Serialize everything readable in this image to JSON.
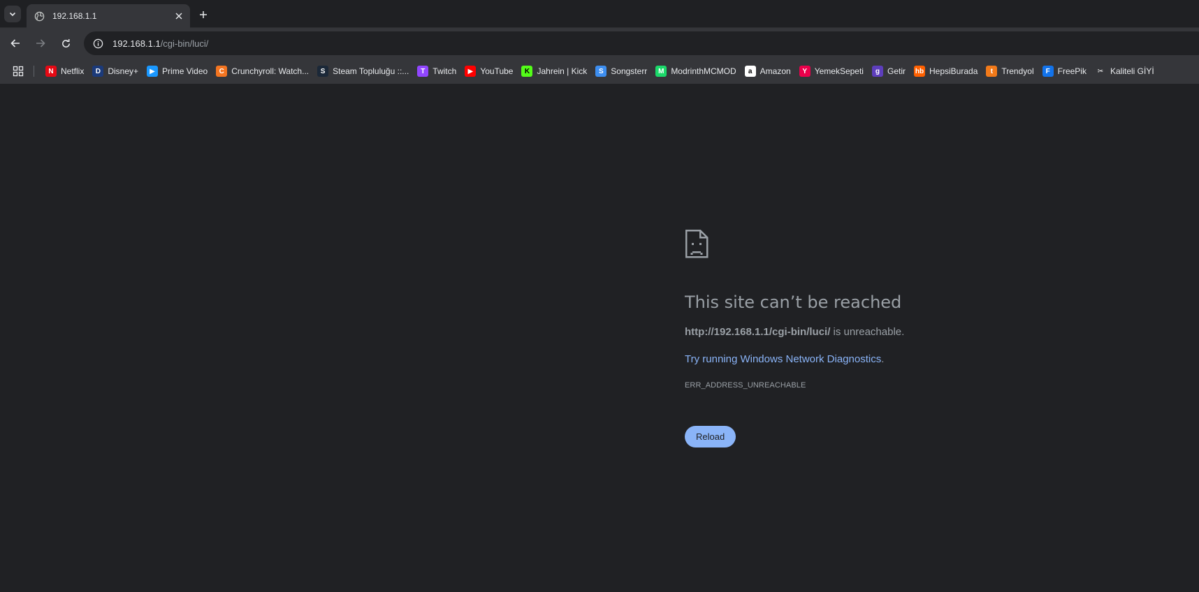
{
  "browser": {
    "tab": {
      "title": "192.168.1.1"
    },
    "omnibox": {
      "host": "192.168.1.1",
      "path": "/cgi-bin/luci/"
    },
    "bookmarks": [
      {
        "label": "Netflix",
        "icon": "netflix-icon",
        "color": "#e50914",
        "glyph": "N"
      },
      {
        "label": "Disney+",
        "icon": "disney-icon",
        "color": "#1b3a7a",
        "glyph": "D"
      },
      {
        "label": "Prime Video",
        "icon": "prime-video-icon",
        "color": "#1a98ff",
        "glyph": "▶"
      },
      {
        "label": "Crunchyroll: Watch...",
        "icon": "crunchyroll-icon",
        "color": "#f47521",
        "glyph": "C"
      },
      {
        "label": "Steam Topluluğu ::...",
        "icon": "steam-icon",
        "color": "#1b2838",
        "glyph": "S"
      },
      {
        "label": "Twitch",
        "icon": "twitch-icon",
        "color": "#9146ff",
        "glyph": "T"
      },
      {
        "label": "YouTube",
        "icon": "youtube-icon",
        "color": "#ff0000",
        "glyph": "▶"
      },
      {
        "label": "Jahrein | Kick",
        "icon": "kick-icon",
        "color": "#53fc18",
        "glyph": "K"
      },
      {
        "label": "Songsterr",
        "icon": "songsterr-icon",
        "color": "#3d8ef0",
        "glyph": "S"
      },
      {
        "label": "ModrinthMCMOD",
        "icon": "modrinth-icon",
        "color": "#1bd96a",
        "glyph": "M"
      },
      {
        "label": "Amazon",
        "icon": "amazon-icon",
        "color": "#ffffff",
        "glyph": "a"
      },
      {
        "label": "YemekSepeti",
        "icon": "yemeksepeti-icon",
        "color": "#ea004b",
        "glyph": "Y"
      },
      {
        "label": "Getir",
        "icon": "getir-icon",
        "color": "#5d3ebc",
        "glyph": "g"
      },
      {
        "label": "HepsiBurada",
        "icon": "hepsiburada-icon",
        "color": "#ff6000",
        "glyph": "hb"
      },
      {
        "label": "Trendyol",
        "icon": "trendyol-icon",
        "color": "#f27a1a",
        "glyph": "t"
      },
      {
        "label": "FreePik",
        "icon": "freepik-icon",
        "color": "#1273eb",
        "glyph": "F"
      },
      {
        "label": "Kaliteli GİYİ",
        "icon": "scissors-icon",
        "color": "#35363a",
        "glyph": "✂"
      }
    ]
  },
  "error": {
    "title": "This site can’t be reached",
    "url_bold": "http://192.168.1.1/cgi-bin/luci/",
    "url_suffix": " is unreachable.",
    "diagnostics_link": "Try running Windows Network Diagnostics",
    "diagnostics_suffix": ".",
    "code": "ERR_ADDRESS_UNREACHABLE",
    "reload_label": "Reload"
  },
  "colors": {
    "page_bg": "#202124",
    "toolbar_bg": "#35363a",
    "link": "#8ab4f8",
    "muted_text": "#9aa0a6"
  }
}
